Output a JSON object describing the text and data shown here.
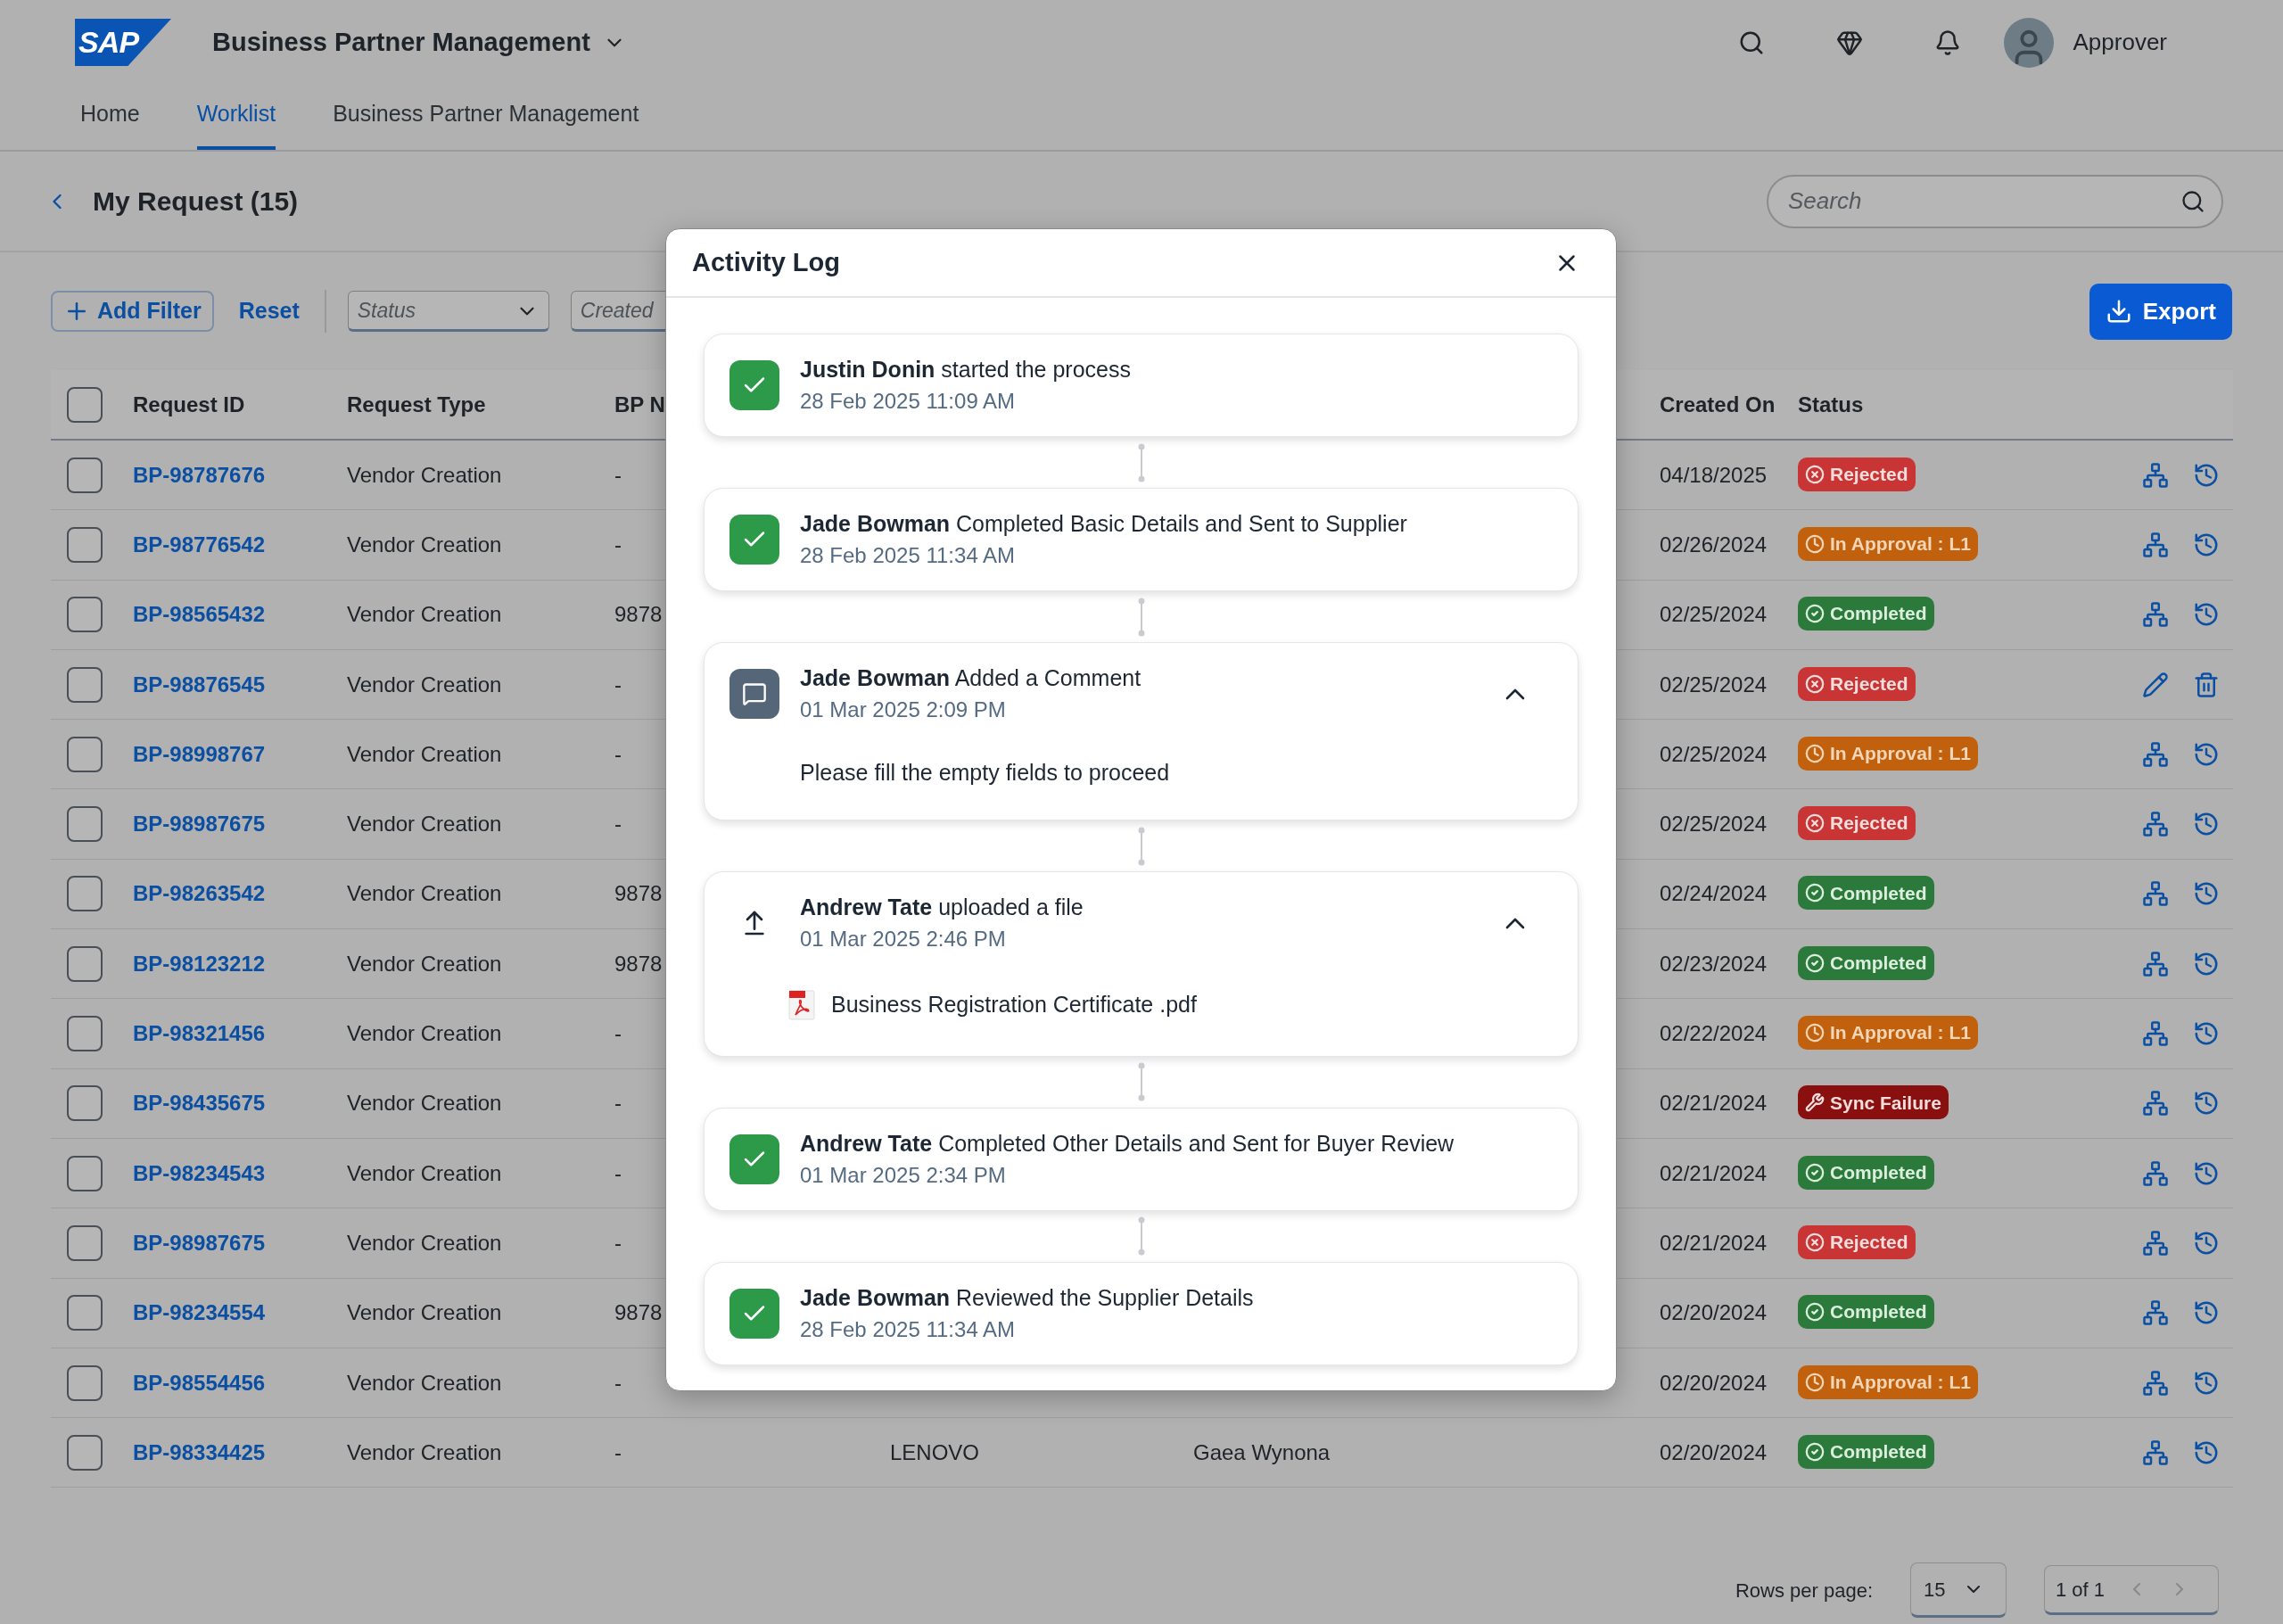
{
  "app": {
    "logo": "SAP",
    "title": "Business Partner Management",
    "user": "Approver"
  },
  "nav_tabs": [
    {
      "label": "Home",
      "selected": false
    },
    {
      "label": "Worklist",
      "selected": true
    },
    {
      "label": "Business Partner Management",
      "selected": false
    }
  ],
  "page": {
    "title": "My Request (15)",
    "search": {
      "placeholder": "Search"
    }
  },
  "filters": {
    "add_filter": "Add Filter",
    "reset": "Reset",
    "fields": [
      {
        "placeholder": "Status",
        "kind": "select"
      },
      {
        "placeholder": "Created",
        "kind": "text"
      }
    ],
    "export": "Export"
  },
  "table": {
    "all_checked": false,
    "columns": [
      {
        "label": "Request ID"
      },
      {
        "label": "Request Type"
      },
      {
        "label": "BP N"
      },
      {
        "label": "Created On"
      },
      {
        "label": "Status"
      }
    ],
    "rows": [
      {
        "checked": false,
        "request_id": "BP-98787676",
        "request_type": "Vendor Creation",
        "column_3": "-",
        "created_on": "04/18/2025",
        "status": {
          "label": "Rejected",
          "kind": "rejected"
        },
        "kind": "track"
      },
      {
        "checked": false,
        "request_id": "BP-98776542",
        "request_type": "Vendor Creation",
        "column_3": "-",
        "created_on": "02/26/2024",
        "status": {
          "label": "In Approval : L1",
          "kind": "in_approval"
        },
        "kind": "track"
      },
      {
        "checked": false,
        "request_id": "BP-98565432",
        "request_type": "Vendor Creation",
        "column_3": "9878",
        "created_on": "02/25/2024",
        "status": {
          "label": "Completed",
          "kind": "completed"
        },
        "kind": "track"
      },
      {
        "checked": false,
        "request_id": "BP-98876545",
        "request_type": "Vendor Creation",
        "column_3": "-",
        "created_on": "02/25/2024",
        "status": {
          "label": "Rejected",
          "kind": "rejected"
        },
        "kind": "edit"
      },
      {
        "checked": false,
        "request_id": "BP-98998767",
        "request_type": "Vendor Creation",
        "column_3": "-",
        "created_on": "02/25/2024",
        "status": {
          "label": "In Approval : L1",
          "kind": "in_approval"
        },
        "kind": "track"
      },
      {
        "checked": false,
        "request_id": "BP-98987675",
        "request_type": "Vendor Creation",
        "column_3": "-",
        "created_on": "02/25/2024",
        "status": {
          "label": "Rejected",
          "kind": "rejected"
        },
        "kind": "track"
      },
      {
        "checked": false,
        "request_id": "BP-98263542",
        "request_type": "Vendor Creation",
        "column_3": "9878",
        "created_on": "02/24/2024",
        "status": {
          "label": "Completed",
          "kind": "completed"
        },
        "kind": "track"
      },
      {
        "checked": false,
        "request_id": "BP-98123212",
        "request_type": "Vendor Creation",
        "column_3": "9878",
        "created_on": "02/23/2024",
        "status": {
          "label": "Completed",
          "kind": "completed"
        },
        "kind": "track"
      },
      {
        "checked": false,
        "request_id": "BP-98321456",
        "request_type": "Vendor Creation",
        "column_3": "-",
        "created_on": "02/22/2024",
        "status": {
          "label": "In Approval : L1",
          "kind": "in_approval"
        },
        "kind": "track"
      },
      {
        "checked": false,
        "request_id": "BP-98435675",
        "request_type": "Vendor Creation",
        "column_3": "-",
        "created_on": "02/21/2024",
        "status": {
          "label": "Sync Failure",
          "kind": "sync_failure"
        },
        "kind": "track"
      },
      {
        "checked": false,
        "request_id": "BP-98234543",
        "request_type": "Vendor Creation",
        "column_3": "-",
        "created_on": "02/21/2024",
        "status": {
          "label": "Completed",
          "kind": "completed"
        },
        "kind": "track"
      },
      {
        "checked": false,
        "request_id": "BP-98987675",
        "request_type": "Vendor Creation",
        "column_3": "-",
        "created_on": "02/21/2024",
        "status": {
          "label": "Rejected",
          "kind": "rejected"
        },
        "kind": "track"
      },
      {
        "checked": false,
        "request_id": "BP-98234554",
        "request_type": "Vendor Creation",
        "column_3": "9878",
        "created_on": "02/20/2024",
        "status": {
          "label": "Completed",
          "kind": "completed"
        },
        "kind": "track"
      },
      {
        "checked": false,
        "request_id": "BP-98554456",
        "request_type": "Vendor Creation",
        "column_3": "-",
        "created_on": "02/20/2024",
        "status": {
          "label": "In Approval : L1",
          "kind": "in_approval"
        },
        "kind": "track"
      },
      {
        "checked": false,
        "request_id": "BP-98334425",
        "request_type": "Vendor Creation",
        "column_3": "-",
        "column_4": "LENOVO",
        "column_5": "Gaea Wynona",
        "created_on": "02/20/2024",
        "status": {
          "label": "Completed",
          "kind": "completed"
        },
        "kind": "track"
      }
    ]
  },
  "pagination": {
    "label": "Rows per page:",
    "rows_per_page": "15",
    "page": "1 of 1"
  },
  "activity_log": {
    "title": "Activity Log",
    "entries": [
      {
        "kind": "done",
        "actor": "Justin Donin",
        "action": "started the process",
        "time": "28 Feb 2025 11:09 AM"
      },
      {
        "kind": "done",
        "actor": "Jade Bowman",
        "action": "Completed Basic Details and Sent to Supplier",
        "time": "28 Feb 2025 11:34 AM"
      },
      {
        "kind": "comment",
        "actor": "Jade Bowman",
        "action": "Added a Comment",
        "time": "01 Mar 2025 2:09 PM",
        "expanded": true,
        "comment": "Please fill the empty fields to proceed"
      },
      {
        "kind": "upload",
        "actor": "Andrew Tate",
        "action": "uploaded a file",
        "time": "01 Mar 2025 2:46 PM",
        "expanded": true,
        "file": "Business Registration Certificate .pdf"
      },
      {
        "kind": "done",
        "actor": "Andrew Tate",
        "action": "Completed Other Details and Sent for Buyer Review",
        "time": "01 Mar 2025 2:34 PM"
      },
      {
        "kind": "done",
        "actor": "Jade Bowman",
        "action": "Reviewed the Supplier Details",
        "time": "28 Feb 2025 11:34 AM"
      }
    ]
  }
}
